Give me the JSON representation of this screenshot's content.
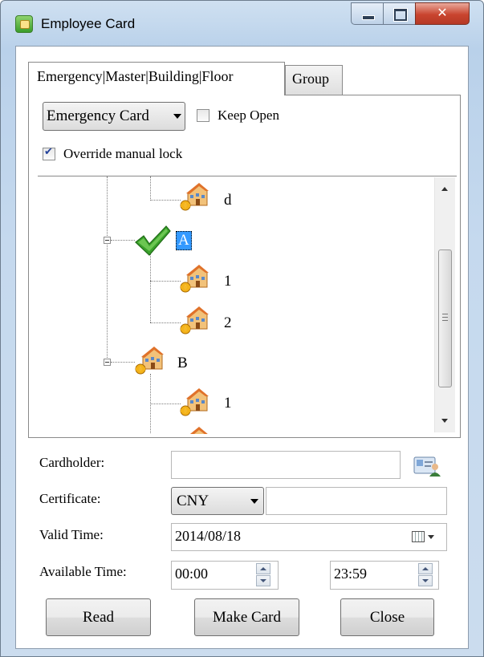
{
  "window": {
    "title": "Employee Card"
  },
  "tabs": [
    {
      "label": "Emergency|Master|Building|Floor",
      "active": true
    },
    {
      "label": "Group",
      "active": false
    }
  ],
  "card_type": {
    "selected": "Emergency Card"
  },
  "keep_open": {
    "label": "Keep Open",
    "checked": false
  },
  "override_lock": {
    "label": "Override manual lock",
    "checked": true
  },
  "tree": {
    "nodes": [
      {
        "label": "d",
        "icon": "building-icon"
      },
      {
        "label": "A",
        "icon": "check-icon",
        "selected": true,
        "expanded": true
      },
      {
        "label": "1",
        "icon": "building-icon"
      },
      {
        "label": "2",
        "icon": "building-icon"
      },
      {
        "label": "B",
        "icon": "building-icon",
        "expanded": true
      },
      {
        "label": "1",
        "icon": "building-icon"
      }
    ]
  },
  "form": {
    "cardholder_label": "Cardholder:",
    "cardholder_value": "",
    "certificate_label": "Certificate:",
    "certificate_type": "CNY",
    "certificate_value": "",
    "valid_time_label": "Valid Time:",
    "valid_time_value": "2014/08/18",
    "available_time_label": "Available Time:",
    "available_from": "00:00",
    "available_to": "23:59"
  },
  "buttons": {
    "read": "Read",
    "make_card": "Make Card",
    "close": "Close"
  },
  "colors": {
    "selection": "#3399ff",
    "check": "#3aa12b",
    "titlebar": "#b9d1ea",
    "close_button": "#c9442f"
  }
}
